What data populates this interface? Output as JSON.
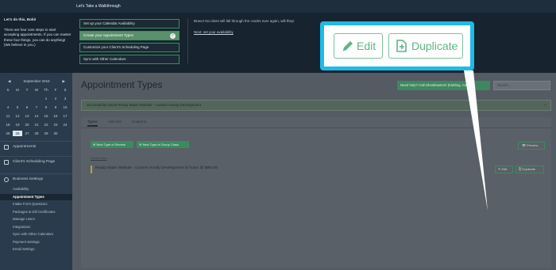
{
  "topbar": {
    "title": "Let's Take a Walkthrough"
  },
  "walkthrough": {
    "greeting": "Let's do this, Bobi!",
    "intro": "There are four core steps to start accepting appointments. If you can master these four things, you can do anything! (We believe in you.)",
    "steps": [
      {
        "label": "Set up your Calendar Availability",
        "done": false
      },
      {
        "label": "Create your Appointment Types",
        "done": true
      },
      {
        "label": "Customize your Client's Scheduling Page",
        "done": false
      },
      {
        "label": "Sync with Other Calendars",
        "done": false
      }
    ],
    "message": "Bravo! No client will fall through the cracks ever again, will they!",
    "next_link": "Next: set your availability"
  },
  "calendar": {
    "month": "September 2016",
    "prev": "◀",
    "next": "▶",
    "weekdays": [
      "S",
      "M",
      "T",
      "W",
      "Th",
      "F",
      "S"
    ],
    "days": [
      "",
      "",
      "",
      "",
      "1",
      "2",
      "3",
      "4",
      "5",
      "6",
      "7",
      "8",
      "9",
      "10",
      "11",
      "12",
      "13",
      "14",
      "15",
      "16",
      "17",
      "18",
      "19",
      "20",
      "21",
      "22",
      "23",
      "24",
      "25",
      "26",
      "27",
      "28",
      "29",
      "30",
      ""
    ],
    "today": "26"
  },
  "sidebar": {
    "appointments": "Appointments",
    "scheduling_page": "Client's Scheduling Page",
    "business_settings": "Business Settings",
    "items": [
      "Availability",
      "Appointment Types",
      "Intake Form Questions",
      "Packages & Gift Certificates",
      "Manage Users",
      "Integrations",
      "Sync with Other Calendars",
      "Payment Settings",
      "Email Settings"
    ],
    "active_item": "Appointment Types"
  },
  "main": {
    "title": "Appointment Types",
    "help_button": "Need help? Call Ghostbusters! (Kidding, Call us)",
    "search_placeholder": "Search...",
    "alert": "Successfully saved Ready Made Website - Custom Hourly Development",
    "alert_close": "×",
    "tabs": [
      "Types",
      "Add-ons",
      "Coupons"
    ],
    "new_service_button": "⊕ New Type of Service",
    "new_group_class_button": "⊕ New Type of Group Class",
    "learn_more": "Learn more",
    "preview_button": "👁 Preview",
    "appointment_row": "Ready Made Website - Custom Hourly Development (5 hours @ $99.00)",
    "row_edit": "✎ Edit",
    "row_duplicate": "⎘ Duplicate"
  },
  "callout": {
    "edit_label": "Edit",
    "duplicate_label": "Duplicate",
    "border_color": "#1dbbe8",
    "button_color": "#5bb782"
  }
}
